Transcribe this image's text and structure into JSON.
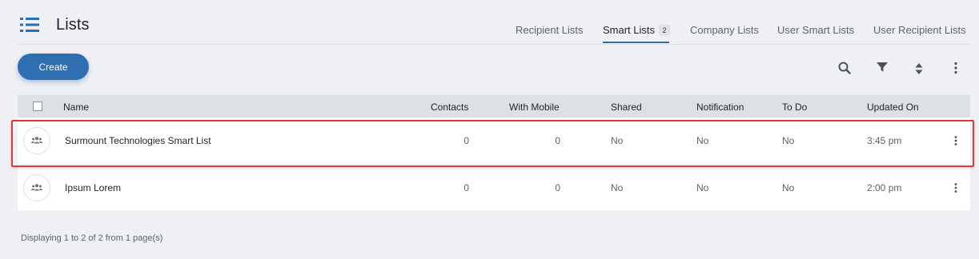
{
  "header": {
    "title": "Lists",
    "icon": "list-icon"
  },
  "tabs": [
    {
      "label": "Recipient Lists",
      "active": false
    },
    {
      "label": "Smart Lists",
      "active": true,
      "badge": "2"
    },
    {
      "label": "Company Lists",
      "active": false
    },
    {
      "label": "User Smart Lists",
      "active": false
    },
    {
      "label": "User Recipient Lists",
      "active": false
    }
  ],
  "toolbar": {
    "create_label": "Create",
    "icons": [
      "search-icon",
      "filter-icon",
      "sort-icon",
      "more-vertical-icon"
    ]
  },
  "table": {
    "columns": [
      "Name",
      "Contacts",
      "With Mobile",
      "Shared",
      "Notification",
      "To Do",
      "Updated On"
    ],
    "rows": [
      {
        "name": "Surmount Technologies Smart List",
        "contacts": "0",
        "with_mobile": "0",
        "shared": "No",
        "notification": "No",
        "todo": "No",
        "updated_on": "3:45 pm",
        "highlighted": true
      },
      {
        "name": "Ipsum Lorem",
        "contacts": "0",
        "with_mobile": "0",
        "shared": "No",
        "notification": "No",
        "todo": "No",
        "updated_on": "2:00 pm",
        "highlighted": false
      }
    ]
  },
  "footer": {
    "pagination_text": "Displaying 1 to 2 of 2 from 1 page(s)"
  },
  "colors": {
    "accent": "#2f6fb1",
    "highlight": "#e0393c",
    "background": "#eef0f3"
  }
}
